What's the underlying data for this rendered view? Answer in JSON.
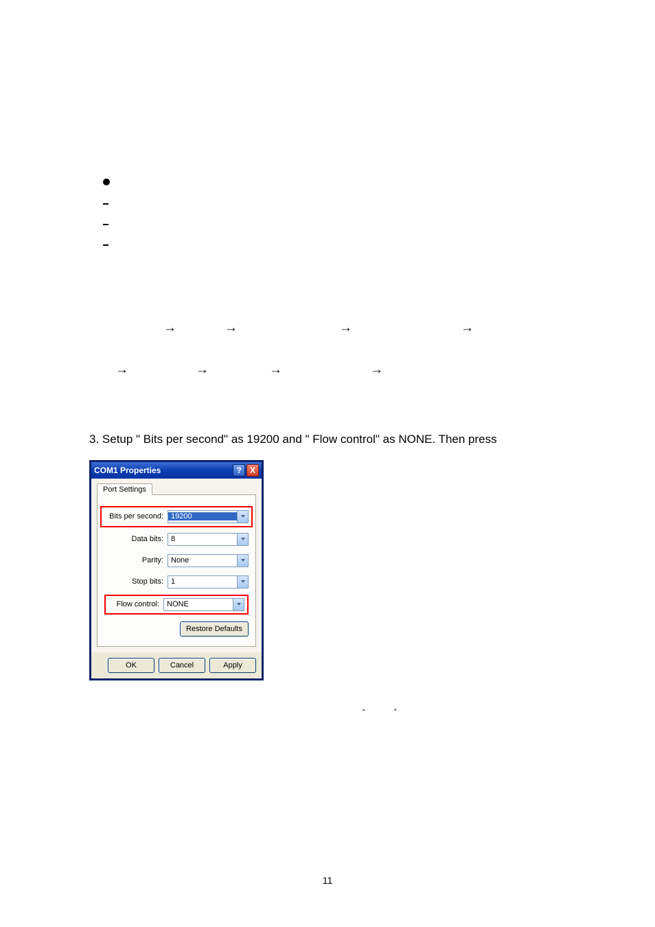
{
  "arrow": "→",
  "instruction": "3. Setup \" Bits per second\" as 19200 and \" Flow control\" as NONE. Then press",
  "dialog": {
    "title": "COM1 Properties",
    "tab": "Port Settings",
    "fields": {
      "bps_label": "Bits per second:",
      "bps_value": "19200",
      "databits_label": "Data bits:",
      "databits_value": "8",
      "parity_label": "Parity:",
      "parity_value": "None",
      "stopbits_label": "Stop bits:",
      "stopbits_value": "1",
      "flow_label": "Flow control:",
      "flow_value": "NONE"
    },
    "buttons": {
      "restore": "Restore Defaults",
      "ok": "OK",
      "cancel": "Cancel",
      "apply": "Apply"
    },
    "sys": {
      "help": "?",
      "close": "X"
    }
  },
  "quotes": {
    "open": "“",
    "close": "”"
  },
  "page_number": "11"
}
